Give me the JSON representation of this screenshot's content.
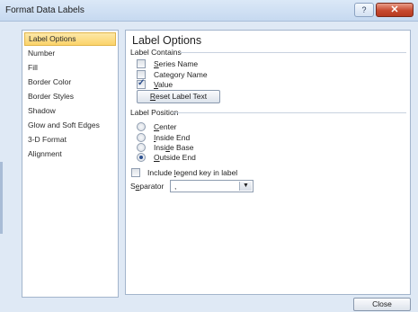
{
  "window": {
    "title": "Format Data Labels",
    "help_label": "?",
    "close_label": "✕"
  },
  "nav": {
    "items": [
      {
        "label": "Label Options"
      },
      {
        "label": "Number"
      },
      {
        "label": "Fill"
      },
      {
        "label": "Border Color"
      },
      {
        "label": "Border Styles"
      },
      {
        "label": "Shadow"
      },
      {
        "label": "Glow and Soft Edges"
      },
      {
        "label": "3-D Format"
      },
      {
        "label": "Alignment"
      }
    ],
    "selected": "Label Options"
  },
  "panel": {
    "heading": "Label Options",
    "label_contains": {
      "title": "Label Contains",
      "series_name": {
        "pre": "",
        "key": "S",
        "post": "eries Name",
        "checked": false
      },
      "category_name": {
        "pre": "Cate",
        "key": "g",
        "post": "ory Name",
        "checked": false
      },
      "value": {
        "pre": "",
        "key": "V",
        "post": "alue",
        "checked": true
      },
      "reset_button": {
        "pre": "",
        "key": "R",
        "post": "eset Label Text"
      }
    },
    "label_position": {
      "title": "Label Position",
      "options": [
        {
          "pre": "",
          "key": "C",
          "post": "enter",
          "selected": false
        },
        {
          "pre": "",
          "key": "I",
          "post": "nside End",
          "selected": false
        },
        {
          "pre": "Insi",
          "key": "d",
          "post": "e Base",
          "selected": false
        },
        {
          "pre": "",
          "key": "O",
          "post": "utside End",
          "selected": true
        }
      ]
    },
    "legend_key": {
      "pre": "Include ",
      "key": "l",
      "post": "egend key in label",
      "checked": false
    },
    "separator": {
      "pre": "S",
      "key": "e",
      "post": "parator",
      "value": ","
    }
  },
  "footer": {
    "close_label": "Close"
  }
}
